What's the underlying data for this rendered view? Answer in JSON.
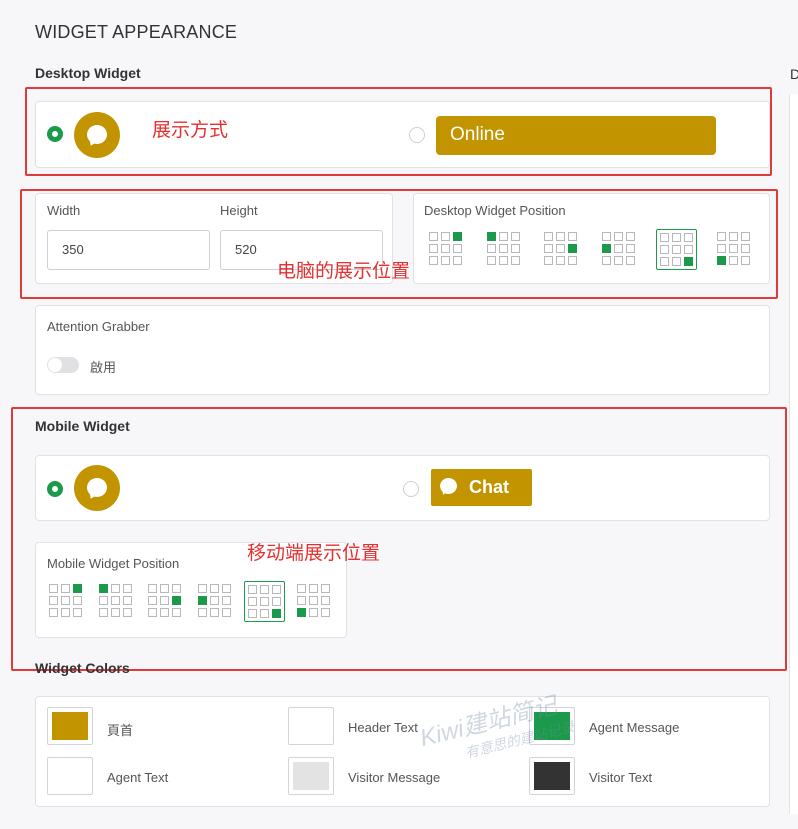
{
  "page": {
    "title": "WIDGET APPEARANCE",
    "side_letter": "D"
  },
  "desktop_widget": {
    "label": "Desktop Widget",
    "online_label": "Online",
    "accent_color": "#c29400",
    "selected_style": "bubble",
    "annotation": "展示方式"
  },
  "dimensions": {
    "width_label": "Width",
    "width_value": "350",
    "height_label": "Height",
    "height_value": "520",
    "annotation": "电脑的展示位置"
  },
  "desktop_position": {
    "label": "Desktop Widget Position",
    "selected_index": 4,
    "options": [
      "top-right",
      "top-left",
      "middle-right",
      "middle-left",
      "bottom-right",
      "bottom-left"
    ]
  },
  "attention": {
    "label": "Attention Grabber",
    "toggle_label": "啟用",
    "enabled": false
  },
  "mobile_widget": {
    "label": "Mobile Widget",
    "chat_label": "Chat",
    "selected_style": "bubble"
  },
  "mobile_position": {
    "label": "Mobile Widget Position",
    "selected_index": 4,
    "options": [
      "top-right",
      "top-left",
      "middle-right",
      "middle-left",
      "bottom-right",
      "bottom-left"
    ],
    "annotation": "移动端展示位置"
  },
  "colors": {
    "label": "Widget Colors",
    "items": [
      {
        "label": "頁首",
        "color": "#c29400"
      },
      {
        "label": "Header Text",
        "color": "#ffffff"
      },
      {
        "label": "Agent Message",
        "color": "#1a9a4a"
      },
      {
        "label": "Agent Text",
        "color": "#ffffff"
      },
      {
        "label": "Visitor Message",
        "color": "#e3e3e3"
      },
      {
        "label": "Visitor Text",
        "color": "#333333"
      }
    ]
  },
  "watermark": {
    "line1": "Kiwi建站简记",
    "line2": "有意思的建站记录"
  }
}
